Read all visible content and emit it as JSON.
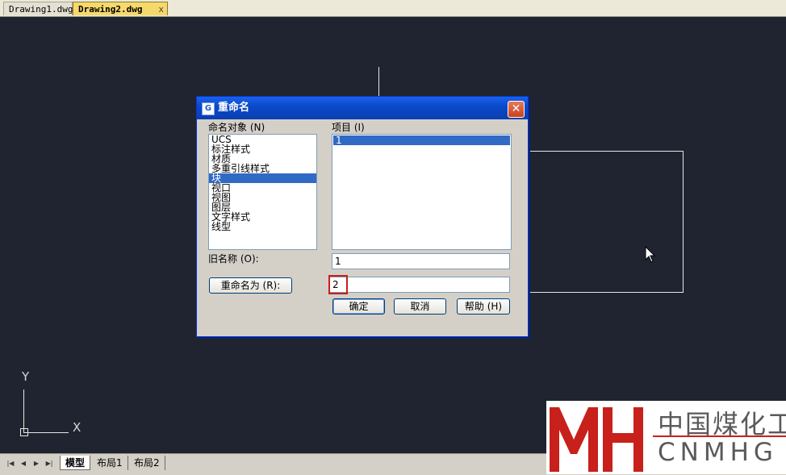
{
  "doc_tabs": [
    {
      "label": "Drawing1.dwg"
    },
    {
      "label": "Drawing2.dwg",
      "close": "x"
    }
  ],
  "ucs": {
    "y_label": "Y",
    "x_label": "X"
  },
  "layout_tabs": [
    "模型",
    "布局1",
    "布局2"
  ],
  "dialog": {
    "title": "重命名",
    "named_objects_label": "命名对象 (N)",
    "items_label": "项目 (I)",
    "named_objects": [
      "UCS",
      "标注样式",
      "材质",
      "多重引线样式",
      "块",
      "视口",
      "视图",
      "图层",
      "文字样式",
      "线型"
    ],
    "selected_object": "块",
    "items": [
      "1"
    ],
    "old_name_label": "旧名称 (O):",
    "old_name_value": "1",
    "rename_to_button": "重命名为 (R):",
    "rename_to_value": "2",
    "ok_button": "确定",
    "cancel_button": "取消",
    "help_button": "帮助 (H)"
  },
  "watermark": {
    "chinese": "中国煤化工",
    "english": "CNMHG"
  },
  "colors": {
    "canvas": "#1f2430",
    "accent": "#316ac5",
    "title_bar": "#0a48c8",
    "watermark_red": "#c8201a"
  }
}
